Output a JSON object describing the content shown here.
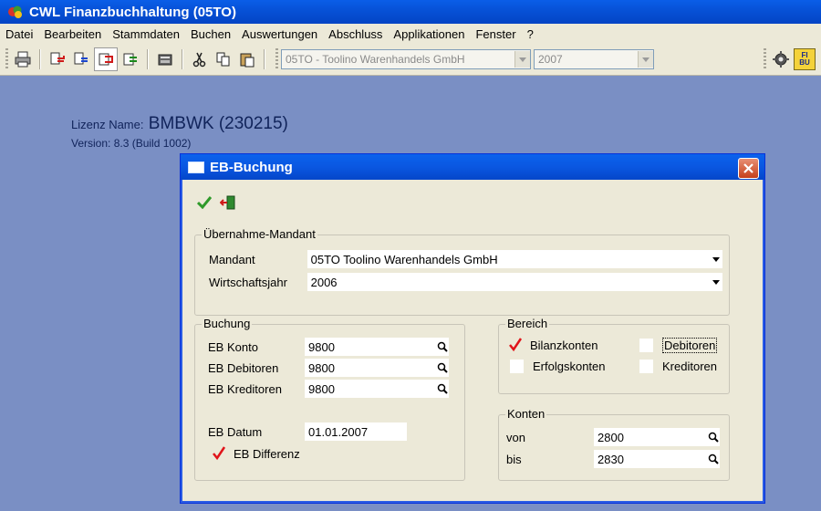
{
  "app": {
    "title": "CWL Finanzbuchhaltung (05TO)"
  },
  "menu": [
    "Datei",
    "Bearbeiten",
    "Stammdaten",
    "Buchen",
    "Auswertungen",
    "Abschluss",
    "Applikationen",
    "Fenster",
    "?"
  ],
  "toolbar": {
    "mandant_combo": "05TO - Toolino Warenhandels GmbH",
    "year_combo": "2007",
    "fibu_label": "FI BU"
  },
  "license": {
    "name_label": "Lizenz Name:",
    "name_value": "BMBWK (230215)",
    "version": "Version: 8.3 (Build 1002)"
  },
  "dialog": {
    "title": "EB-Buchung",
    "uebernahme": {
      "legend": "Übernahme-Mandant",
      "mandant_label": "Mandant",
      "mandant_value": "05TO Toolino Warenhandels GmbH",
      "wj_label": "Wirtschaftsjahr",
      "wj_value": "2006"
    },
    "buchung": {
      "legend": "Buchung",
      "eb_konto_label": "EB Konto",
      "eb_konto_value": "9800",
      "eb_debitoren_label": "EB Debitoren",
      "eb_debitoren_value": "9800",
      "eb_kreditoren_label": "EB Kreditoren",
      "eb_kreditoren_value": "9800",
      "eb_datum_label": "EB Datum",
      "eb_datum_value": "01.01.2007",
      "eb_differenz_label": "EB Differenz",
      "eb_differenz_checked": true
    },
    "bereich": {
      "legend": "Bereich",
      "bilanzkonten": "Bilanzkonten",
      "bilanzkonten_checked": true,
      "erfolgskonten": "Erfolgskonten",
      "erfolgskonten_checked": false,
      "debitoren": "Debitoren",
      "debitoren_checked": false,
      "kreditoren": "Kreditoren",
      "kreditoren_checked": false
    },
    "konten": {
      "legend": "Konten",
      "von_label": "von",
      "von_value": "2800",
      "bis_label": "bis",
      "bis_value": "2830"
    }
  },
  "colors": {
    "titlebar": "#0a57e1",
    "workspace": "#7a8fc4",
    "dialog_bg": "#ece9d8",
    "check_red": "#e0141a",
    "ok_green": "#2f9a2a"
  }
}
